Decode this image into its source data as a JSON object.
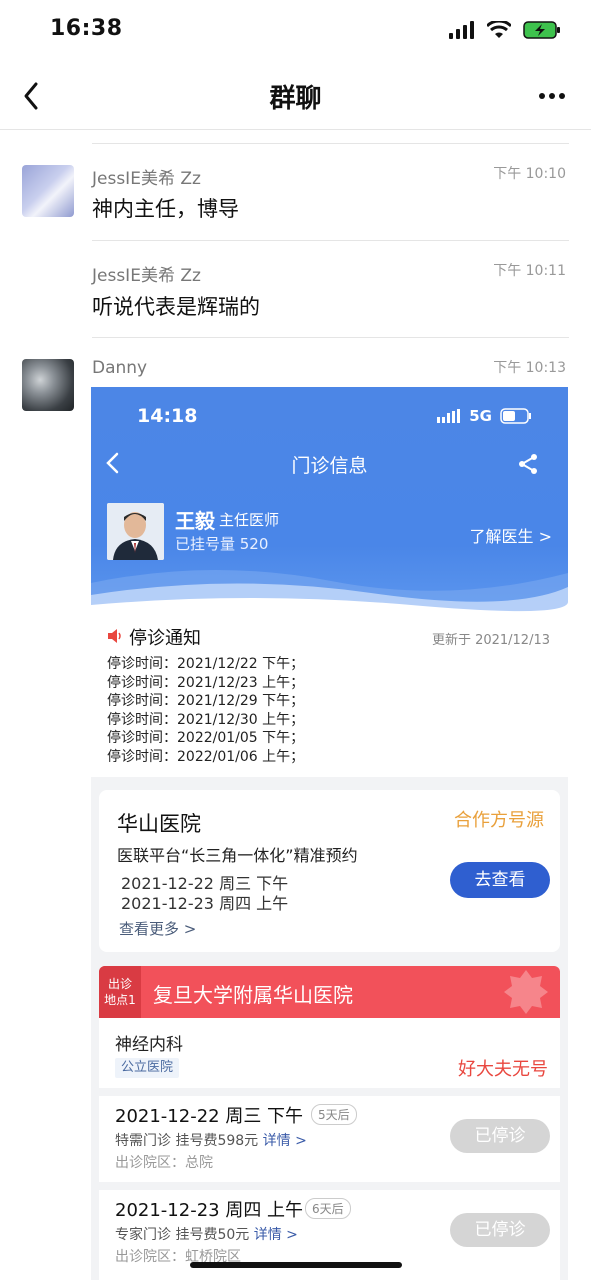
{
  "status_bar": {
    "time": "16:38"
  },
  "nav": {
    "title": "群聊"
  },
  "messages": [
    {
      "sender": "JessIE美希 Zz",
      "time": "下午 10:10",
      "text": "神内主任，博导"
    },
    {
      "sender": "JessIE美希 Zz",
      "time": "下午 10:11",
      "text": "听说代表是辉瑞的"
    },
    {
      "sender": "Danny",
      "time": "下午 10:13"
    }
  ],
  "shot": {
    "status_time": "14:18",
    "network": "5G",
    "title": "门诊信息",
    "doctor_name": "王毅",
    "doctor_title": "主任医师",
    "registered": "已挂号量 520",
    "learn_more": "了解医生 >",
    "notice_title": "停诊通知",
    "notice_updated": "更新于 2021/12/13",
    "notice_lines": [
      "停诊时间：2021/12/22 下午；",
      "停诊时间：2021/12/23 上午；",
      "停诊时间：2021/12/29 下午；",
      "停诊时间：2021/12/30 上午；",
      "停诊时间：2022/01/05 下午；",
      "停诊时间：2022/01/06 上午；"
    ],
    "card1": {
      "hospital": "华山医院",
      "source": "合作方号源",
      "desc": "医联平台“长三角一体化”精准预约",
      "date1": "2021-12-22 周三  下午",
      "date2": "2021-12-23 周四  上午",
      "more": "查看更多 >",
      "button": "去查看"
    },
    "card2": {
      "tag_line1": "出诊",
      "tag_line2": "地点1",
      "hospital": "复旦大学附属华山医院",
      "dept": "神经内科",
      "public_tag": "公立医院",
      "no_slots": "好大夫无号",
      "slots": [
        {
          "date": "2021-12-22 周三 下午",
          "days": "5天后",
          "info": "特需门诊 挂号费598元",
          "detail": "详情 >",
          "loc": "出诊院区：总院",
          "status": "已停诊"
        },
        {
          "date": "2021-12-23 周四 上午",
          "days": "6天后",
          "info": "专家门诊 挂号费50元",
          "detail": "详情 >",
          "loc": "出诊院区：虹桥院区",
          "status": "已停诊"
        }
      ]
    }
  }
}
